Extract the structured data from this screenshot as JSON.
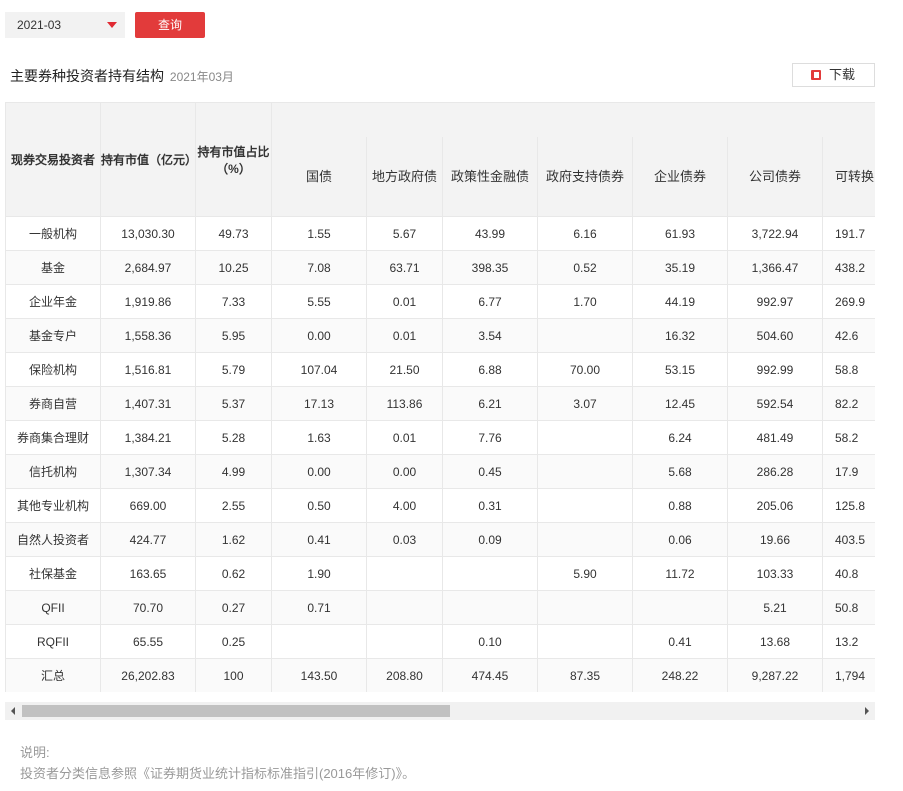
{
  "toolbar": {
    "date_value": "2021-03",
    "query_label": "查询",
    "download_label": "下载"
  },
  "header": {
    "title": "主要券种投资者持有结构",
    "subtitle": "2021年03月"
  },
  "table": {
    "columns": [
      "现券交易投资者",
      "持有市值（亿元）",
      "持有市值占比（%）",
      "国债",
      "地方政府债",
      "政策性金融债",
      "政府支持债券",
      "企业债券",
      "公司债券",
      "可转换"
    ],
    "rows": [
      [
        "一般机构",
        "13,030.30",
        "49.73",
        "1.55",
        "5.67",
        "43.99",
        "6.16",
        "61.93",
        "3,722.94",
        "191.7"
      ],
      [
        "基金",
        "2,684.97",
        "10.25",
        "7.08",
        "63.71",
        "398.35",
        "0.52",
        "35.19",
        "1,366.47",
        "438.2"
      ],
      [
        "企业年金",
        "1,919.86",
        "7.33",
        "5.55",
        "0.01",
        "6.77",
        "1.70",
        "44.19",
        "992.97",
        "269.9"
      ],
      [
        "基金专户",
        "1,558.36",
        "5.95",
        "0.00",
        "0.01",
        "3.54",
        "",
        "16.32",
        "504.60",
        "42.6"
      ],
      [
        "保险机构",
        "1,516.81",
        "5.79",
        "107.04",
        "21.50",
        "6.88",
        "70.00",
        "53.15",
        "992.99",
        "58.8"
      ],
      [
        "券商自营",
        "1,407.31",
        "5.37",
        "17.13",
        "113.86",
        "6.21",
        "3.07",
        "12.45",
        "592.54",
        "82.2"
      ],
      [
        "券商集合理财",
        "1,384.21",
        "5.28",
        "1.63",
        "0.01",
        "7.76",
        "",
        "6.24",
        "481.49",
        "58.2"
      ],
      [
        "信托机构",
        "1,307.34",
        "4.99",
        "0.00",
        "0.00",
        "0.45",
        "",
        "5.68",
        "286.28",
        "17.9"
      ],
      [
        "其他专业机构",
        "669.00",
        "2.55",
        "0.50",
        "4.00",
        "0.31",
        "",
        "0.88",
        "205.06",
        "125.8"
      ],
      [
        "自然人投资者",
        "424.77",
        "1.62",
        "0.41",
        "0.03",
        "0.09",
        "",
        "0.06",
        "19.66",
        "403.5"
      ],
      [
        "社保基金",
        "163.65",
        "0.62",
        "1.90",
        "",
        "",
        "5.90",
        "11.72",
        "103.33",
        "40.8"
      ],
      [
        "QFII",
        "70.70",
        "0.27",
        "0.71",
        "",
        "",
        "",
        "",
        "5.21",
        "50.8"
      ],
      [
        "RQFII",
        "65.55",
        "0.25",
        "",
        "",
        "0.10",
        "",
        "0.41",
        "13.68",
        "13.2"
      ],
      [
        "汇总",
        "26,202.83",
        "100",
        "143.50",
        "208.80",
        "474.45",
        "87.35",
        "248.22",
        "9,287.22",
        "1,794"
      ]
    ]
  },
  "notes": {
    "label": "说明:",
    "text": "投资者分类信息参照《证券期货业统计指标标准指引(2016年修订)》。"
  }
}
